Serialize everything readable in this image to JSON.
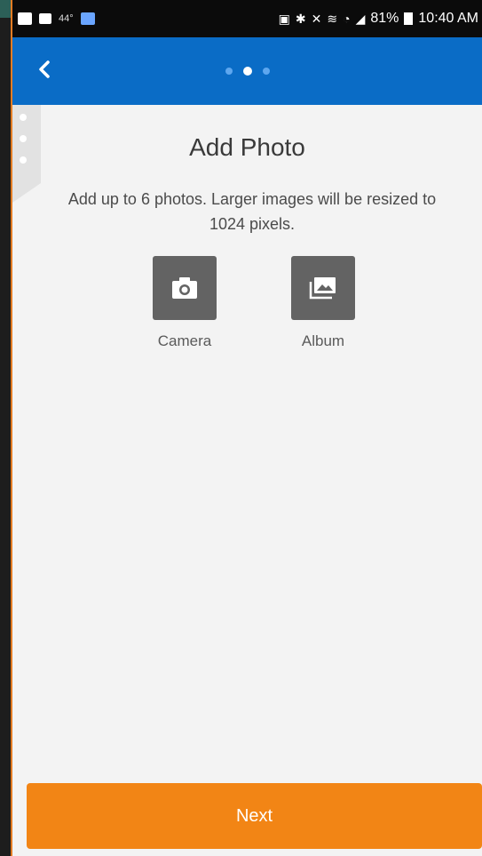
{
  "status_bar": {
    "temperature": "44°",
    "battery_percent": "81%",
    "time": "10:40 AM"
  },
  "nav": {
    "page_dots": 3,
    "active_dot_index": 1
  },
  "content": {
    "title": "Add Photo",
    "description": "Add up to 6 photos. Larger images will be resized to 1024 pixels.",
    "options": [
      {
        "label": "Camera",
        "icon": "camera-icon"
      },
      {
        "label": "Album",
        "icon": "photo-album-icon"
      }
    ]
  },
  "footer": {
    "next_label": "Next"
  },
  "colors": {
    "app_bar": "#0a6cc6",
    "primary_button": "#f28515",
    "tile": "#636363"
  }
}
